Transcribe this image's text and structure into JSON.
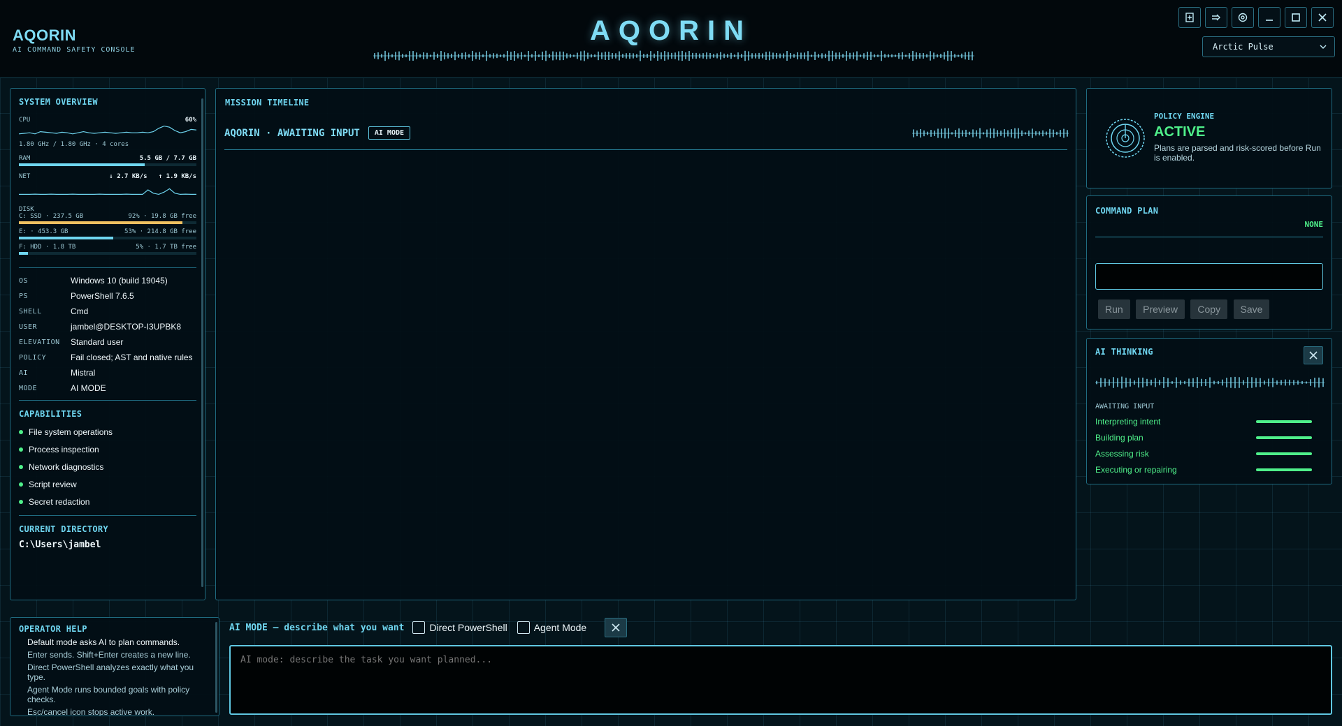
{
  "header": {
    "brand_title": "AQORIN",
    "brand_subtitle": "AI COMMAND SAFETY CONSOLE",
    "center_title": "AQORIN",
    "theme": "Arctic Pulse",
    "toolbar_icons": [
      "document-icon",
      "export-icon",
      "settings-icon",
      "minimize-icon",
      "maximize-icon",
      "close-icon"
    ]
  },
  "system": {
    "title": "SYSTEM OVERVIEW",
    "cpu_label": "CPU",
    "cpu_value": "60%",
    "cpu_detail": "1.80 GHz / 1.80 GHz · 4 cores",
    "ram_label": "RAM",
    "ram_value": "5.5 GB / 7.7 GB",
    "ram_fraction": 0.71,
    "net_label": "NET",
    "net_down": "↓ 2.7 KB/s",
    "net_up": "↑ 1.9 KB/s",
    "disk_label": "DISK",
    "disks": [
      {
        "name": "C: SSD · 237.5 GB",
        "usage": "92% · 19.8 GB free",
        "fraction": 0.92,
        "color": "#f0c060"
      },
      {
        "name": "E: · 453.3 GB",
        "usage": "53% · 214.8 GB free",
        "fraction": 0.53,
        "color": "#6fd6f0"
      },
      {
        "name": "F: HDD · 1.8 TB",
        "usage": "5% · 1.7 TB free",
        "fraction": 0.05,
        "color": "#6fd6f0"
      }
    ],
    "info": [
      {
        "k": "OS",
        "v": "Windows 10 (build 19045)"
      },
      {
        "k": "PS",
        "v": "PowerShell 7.6.5"
      },
      {
        "k": "SHELL",
        "v": "Cmd"
      },
      {
        "k": "USER",
        "v": "jambel@DESKTOP-I3UPBK8"
      },
      {
        "k": "ELEVATION",
        "v": "Standard user"
      },
      {
        "k": "POLICY",
        "v": "Fail closed; AST and native rules"
      },
      {
        "k": "AI",
        "v": "Mistral"
      },
      {
        "k": "MODE",
        "v": "AI MODE"
      }
    ],
    "capabilities_title": "CAPABILITIES",
    "capabilities": [
      "File system operations",
      "Process inspection",
      "Network diagnostics",
      "Script review",
      "Secret redaction"
    ],
    "cwd_title": "CURRENT DIRECTORY",
    "cwd": "C:\\Users\\jambel"
  },
  "mission": {
    "title": "MISSION TIMELINE",
    "status": "AQORIN · AWAITING INPUT",
    "mode_badge": "AI MODE"
  },
  "policy": {
    "label": "POLICY ENGINE",
    "status": "ACTIVE",
    "description": "Plans are parsed and risk-scored before Run is enabled."
  },
  "plan": {
    "title": "COMMAND PLAN",
    "risk": "NONE",
    "buttons": {
      "run": "Run",
      "preview": "Preview",
      "copy": "Copy",
      "save": "Save"
    }
  },
  "thinking": {
    "title": "AI THINKING",
    "state": "AWAITING INPUT",
    "steps": [
      "Interpreting intent",
      "Building plan",
      "Assessing risk",
      "Executing or repairing"
    ]
  },
  "help": {
    "title": "OPERATOR HELP",
    "lead": "Default mode asks AI to plan commands.",
    "lines": [
      "Enter sends. Shift+Enter creates a new line.",
      "Direct PowerShell analyzes exactly what you type.",
      "Agent Mode runs bounded goals with policy checks.",
      "Esc/cancel icon stops active work."
    ]
  },
  "input": {
    "mode_prompt": "AI MODE — describe what you want",
    "direct_label": "Direct PowerShell",
    "agent_label": "Agent Mode",
    "placeholder": "AI mode: describe the task you want planned..."
  }
}
